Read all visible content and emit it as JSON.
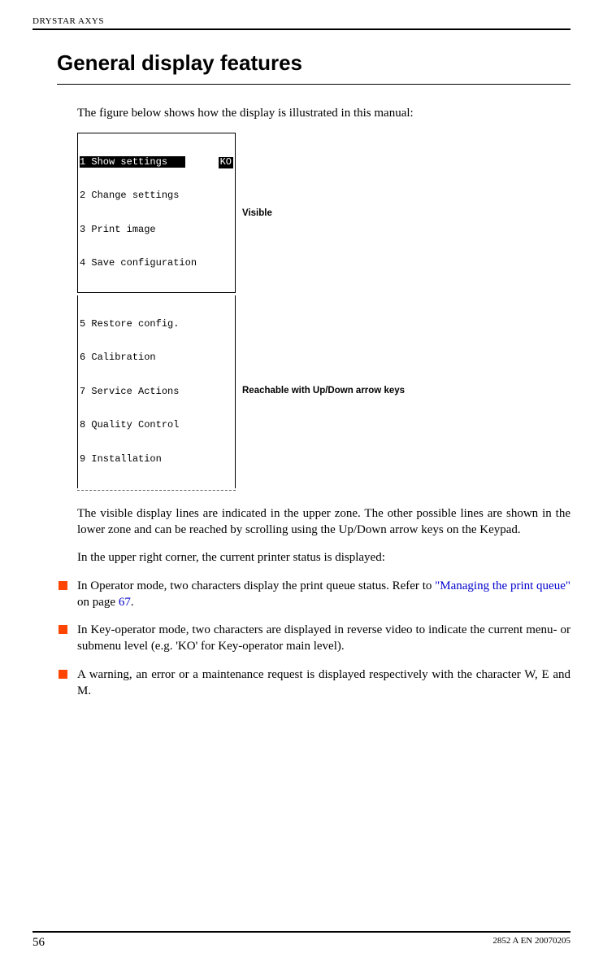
{
  "header": {
    "product": "DRYSTAR AXYS"
  },
  "title": "General display features",
  "intro": "The figure below shows how the display is illustrated in this manual:",
  "figure": {
    "upper": {
      "rows": [
        {
          "num": "1",
          "text": "Show settings",
          "selected": true,
          "badge": "KO"
        },
        {
          "num": "2",
          "text": "Change settings"
        },
        {
          "num": "3",
          "text": "Print image"
        },
        {
          "num": "4",
          "text": "Save configuration"
        }
      ],
      "label": "Visible"
    },
    "lower": {
      "rows": [
        {
          "num": "5",
          "text": "Restore config."
        },
        {
          "num": "6",
          "text": "Calibration"
        },
        {
          "num": "7",
          "text": "Service Actions"
        },
        {
          "num": "8",
          "text": "Quality Control"
        },
        {
          "num": "9",
          "text": "Installation"
        }
      ],
      "label": "Reachable with Up/Down arrow keys"
    }
  },
  "para1": "The visible display lines are indicated in the upper zone. The other possible lines are shown in the lower zone and can be reached by scrolling using the Up/Down arrow keys on the Keypad.",
  "para2": "In the upper right corner, the current printer status is displayed:",
  "bullets": {
    "b1": {
      "pre": "In Operator mode, two characters display the print queue status. Refer to ",
      "link1": "\"Managing the print queue\"",
      "mid": " on page ",
      "link2": "67",
      "post": "."
    },
    "b2": "In Key-operator mode, two characters are displayed in reverse video to indicate the current menu- or submenu level (e.g. 'KO' for Key-operator main level).",
    "b3": "A warning, an error or a maintenance request is displayed respectively with the character W, E and M."
  },
  "footer": {
    "page": "56",
    "docid": "2852 A EN 20070205"
  }
}
